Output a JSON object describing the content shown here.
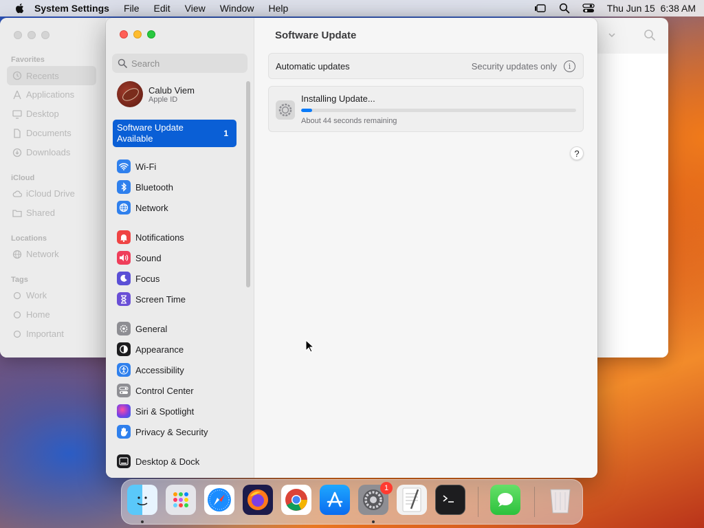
{
  "menubar": {
    "app_name": "System Settings",
    "items": [
      "File",
      "Edit",
      "View",
      "Window",
      "Help"
    ],
    "datetime": "Thu Jun 15  6:38 AM"
  },
  "finder": {
    "sections": {
      "favorites": "Favorites",
      "icloud": "iCloud",
      "locations": "Locations",
      "tags": "Tags"
    },
    "favorites": [
      "Recents",
      "Applications",
      "Desktop",
      "Documents",
      "Downloads"
    ],
    "icloud": [
      "iCloud Drive",
      "Shared"
    ],
    "locations": [
      "Network"
    ],
    "tags": [
      "Work",
      "Home",
      "Important"
    ]
  },
  "settings": {
    "search_placeholder": "Search",
    "account": {
      "name": "Calub Viem",
      "sub": "Apple ID"
    },
    "update_banner": {
      "label": "Software Update Available",
      "count": "1"
    },
    "sidebar": [
      {
        "label": "Wi-Fi",
        "icon": "wifi-icon",
        "color": "#2f80ed"
      },
      {
        "label": "Bluetooth",
        "icon": "bluetooth-icon",
        "color": "#2f80ed"
      },
      {
        "label": "Network",
        "icon": "globe-icon",
        "color": "#2f80ed"
      },
      {
        "label": "Notifications",
        "icon": "bell-icon",
        "color": "#ef4444"
      },
      {
        "label": "Sound",
        "icon": "speaker-icon",
        "color": "#ef3e5a"
      },
      {
        "label": "Focus",
        "icon": "moon-icon",
        "color": "#5a4fd6"
      },
      {
        "label": "Screen Time",
        "icon": "hourglass-icon",
        "color": "#6a4fd6"
      },
      {
        "label": "General",
        "icon": "gear-icon",
        "color": "#8e8e93"
      },
      {
        "label": "Appearance",
        "icon": "appearance-icon",
        "color": "#1d1d1f"
      },
      {
        "label": "Accessibility",
        "icon": "accessibility-icon",
        "color": "#2f80ed"
      },
      {
        "label": "Control Center",
        "icon": "control-center-icon",
        "color": "#8e8e93"
      },
      {
        "label": "Siri & Spotlight",
        "icon": "siri-icon",
        "color": "#7b3fe4"
      },
      {
        "label": "Privacy & Security",
        "icon": "hand-icon",
        "color": "#2f80ed"
      },
      {
        "label": "Desktop & Dock",
        "icon": "dock-icon",
        "color": "#1d1d1f"
      }
    ],
    "main": {
      "title": "Software Update",
      "auto_label": "Automatic updates",
      "auto_value": "Security updates only",
      "install_title": "Installing Update...",
      "install_progress_percent": 4,
      "install_remaining": "About 44 seconds remaining",
      "help_label": "?"
    }
  },
  "dock": {
    "apps": [
      "Finder",
      "Launchpad",
      "Safari",
      "Firefox",
      "Chrome",
      "App Store",
      "System Settings",
      "TextEdit",
      "Terminal",
      "Messages",
      "Trash"
    ],
    "system_settings_badge": "1"
  }
}
